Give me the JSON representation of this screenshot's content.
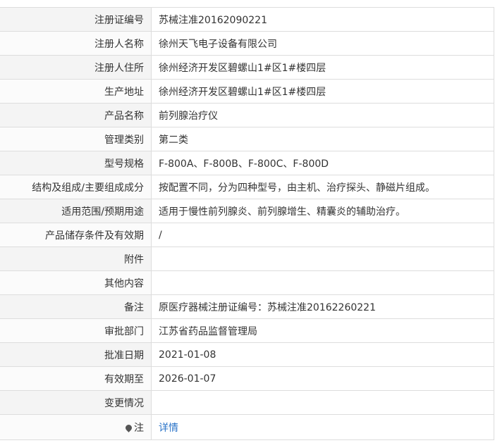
{
  "rows": [
    {
      "label": "注册证编号",
      "value": "苏械注准20162090221"
    },
    {
      "label": "注册人名称",
      "value": "徐州天飞电子设备有限公司"
    },
    {
      "label": "注册人住所",
      "value": "徐州经济开发区碧螺山1#区1#楼四层"
    },
    {
      "label": "生产地址",
      "value": "徐州经济开发区碧螺山1#区1#楼四层"
    },
    {
      "label": "产品名称",
      "value": "前列腺治疗仪"
    },
    {
      "label": "管理类别",
      "value": "第二类"
    },
    {
      "label": "型号规格",
      "value": "F-800A、F-800B、F-800C、F-800D"
    },
    {
      "label": "结构及组成/主要组成成分",
      "value": "按配置不同，分为四种型号，由主机、治疗探头、静磁片组成。"
    },
    {
      "label": "适用范围/预期用途",
      "value": "适用于慢性前列腺炎、前列腺增生、精囊炎的辅助治疗。"
    },
    {
      "label": "产品储存条件及有效期",
      "value": "/"
    },
    {
      "label": "附件",
      "value": ""
    },
    {
      "label": "其他内容",
      "value": ""
    },
    {
      "label": "备注",
      "value": "原医疗器械注册证编号：苏械注准20162260221"
    },
    {
      "label": "审批部门",
      "value": "江苏省药品监督管理局"
    },
    {
      "label": "批准日期",
      "value": "2021-01-08"
    },
    {
      "label": "有效期至",
      "value": "2026-01-07"
    },
    {
      "label": "变更情况",
      "value": ""
    }
  ],
  "note": {
    "label": "注",
    "icon": "pin-icon",
    "link_text": "详情"
  }
}
